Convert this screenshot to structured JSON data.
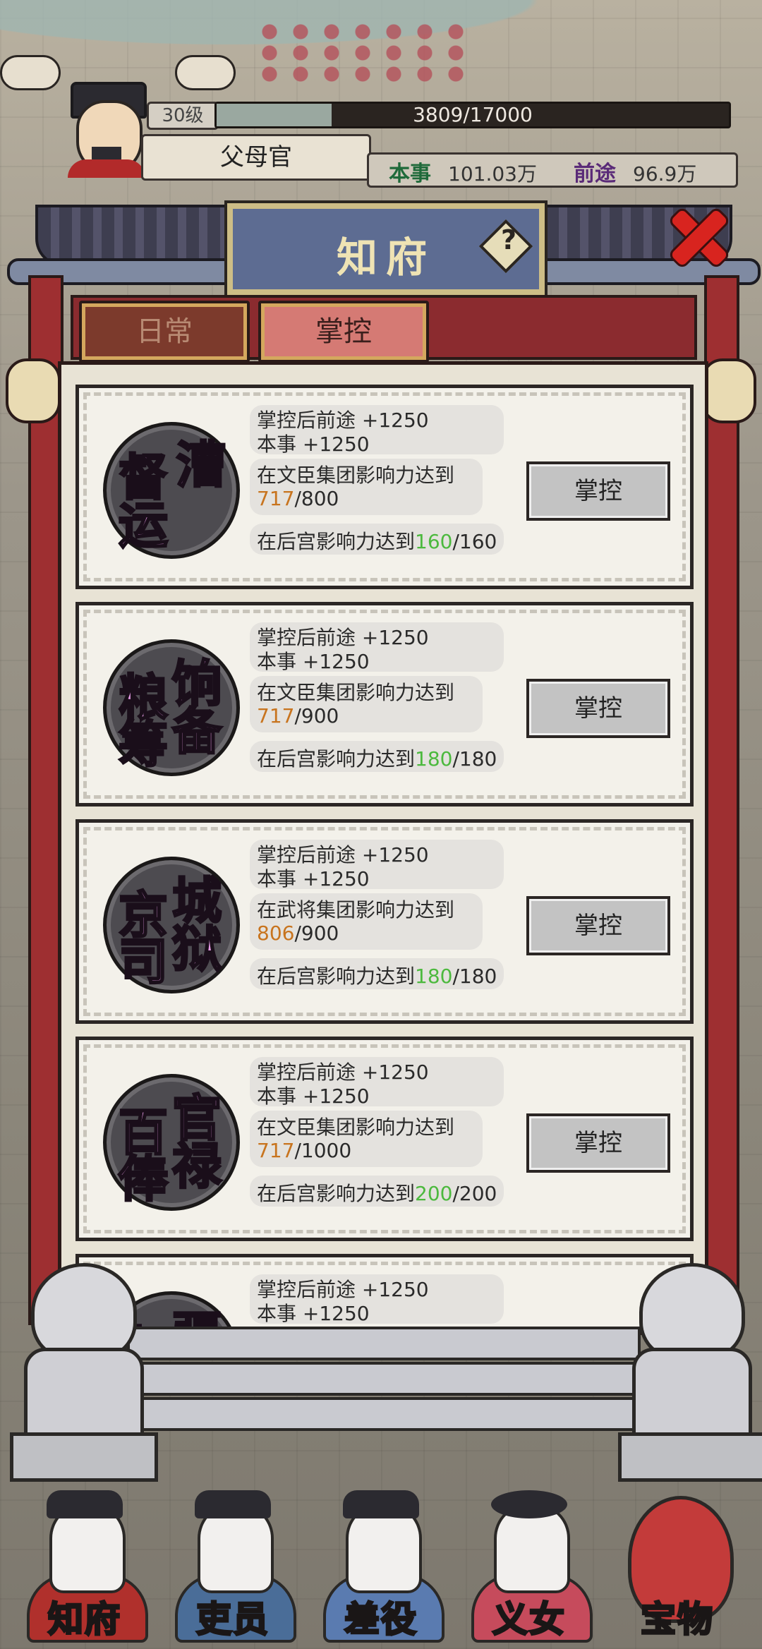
{
  "player": {
    "level": "30级",
    "xp_text": "3809/17000",
    "xp_current": 3809,
    "xp_max": 17000,
    "rank_title": "父母官",
    "ability_label": "本事",
    "ability_value": "101.03万",
    "prospect_label": "前途",
    "prospect_value": "96.9万"
  },
  "dialog": {
    "title": "知府",
    "help_icon": "question-mark",
    "close_icon": "red-x"
  },
  "tabs": [
    {
      "label": "日常",
      "active": false
    },
    {
      "label": "掌控",
      "active": true
    }
  ],
  "cards": [
    {
      "seal_chars": [
        "漕",
        "督",
        "运"
      ],
      "reward_line1": "掌控后前途 +1250",
      "reward_line2": "本事 +1250",
      "req1_text": "在文臣集团影响力达到",
      "req1_current": "717",
      "req1_target": "/800",
      "req2_text": "在后宫影响力达到",
      "req2_current": "160",
      "req2_target": "/160",
      "button": "掌控"
    },
    {
      "seal_chars": [
        "饷",
        "粮",
        "筹",
        "备"
      ],
      "reward_line1": "掌控后前途 +1250",
      "reward_line2": "本事 +1250",
      "req1_text": "在文臣集团影响力达到",
      "req1_current": "717",
      "req1_target": "/900",
      "req2_text": "在后宫影响力达到",
      "req2_current": "180",
      "req2_target": "/180",
      "button": "掌控"
    },
    {
      "seal_chars": [
        "城",
        "京",
        "司",
        "狱"
      ],
      "reward_line1": "掌控后前途 +1250",
      "reward_line2": "本事 +1250",
      "req1_text": "在武将集团影响力达到",
      "req1_current": "806",
      "req1_target": "/900",
      "req2_text": "在后宫影响力达到",
      "req2_current": "180",
      "req2_target": "/180",
      "button": "掌控"
    },
    {
      "seal_chars": [
        "官",
        "百",
        "俸",
        "禄"
      ],
      "reward_line1": "掌控后前途 +1250",
      "reward_line2": "本事 +1250",
      "req1_text": "在文臣集团影响力达到",
      "req1_current": "717",
      "req1_target": "/1000",
      "req2_text": "在后宫影响力达到",
      "req2_current": "200",
      "req2_target": "/200",
      "button": "掌控"
    },
    {
      "seal_chars": [
        "九",
        "疆"
      ],
      "reward_line1": "掌控后前途 +1250",
      "reward_line2": "本事 +1250",
      "partial": true
    }
  ],
  "nav": [
    {
      "label": "知府"
    },
    {
      "label": "吏员"
    },
    {
      "label": "差役"
    },
    {
      "label": "义女"
    },
    {
      "label": "宝物"
    }
  ],
  "colors": {
    "accent_red": "#9e2f31",
    "seal_text": "#e79ce6",
    "current_value": "#c8741e",
    "met_value": "#4cb93e",
    "title_board": "#5d6c92"
  }
}
